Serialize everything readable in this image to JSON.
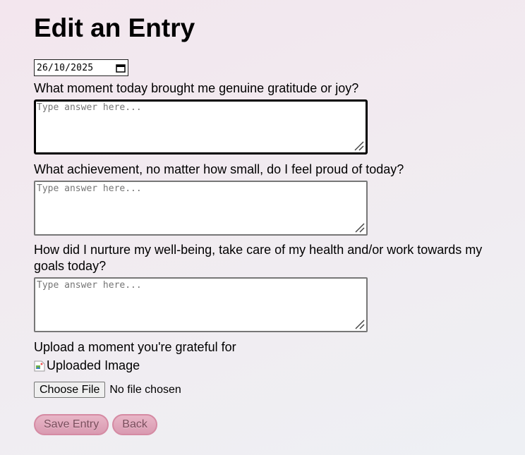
{
  "header": {
    "title": "Edit an Entry"
  },
  "date_field": {
    "value": "26/10/2025",
    "icon": "calendar-icon"
  },
  "questions": [
    {
      "label": "What moment today brought me genuine gratitude or joy?",
      "placeholder": "Type answer here..."
    },
    {
      "label": "What achievement, no matter how small, do I feel proud of today?",
      "placeholder": "Type answer here..."
    },
    {
      "label": "How did I nurture my well-being, take care of my health and/or work towards my goals today?",
      "placeholder": "Type answer here..."
    }
  ],
  "upload": {
    "label": "Upload a moment you're grateful for",
    "image_alt": "Uploaded Image",
    "choose_button": "Choose File",
    "status": "No file chosen"
  },
  "actions": {
    "save_label": "Save Entry",
    "back_label": "Back",
    "accent_color": "#d99ab1"
  }
}
